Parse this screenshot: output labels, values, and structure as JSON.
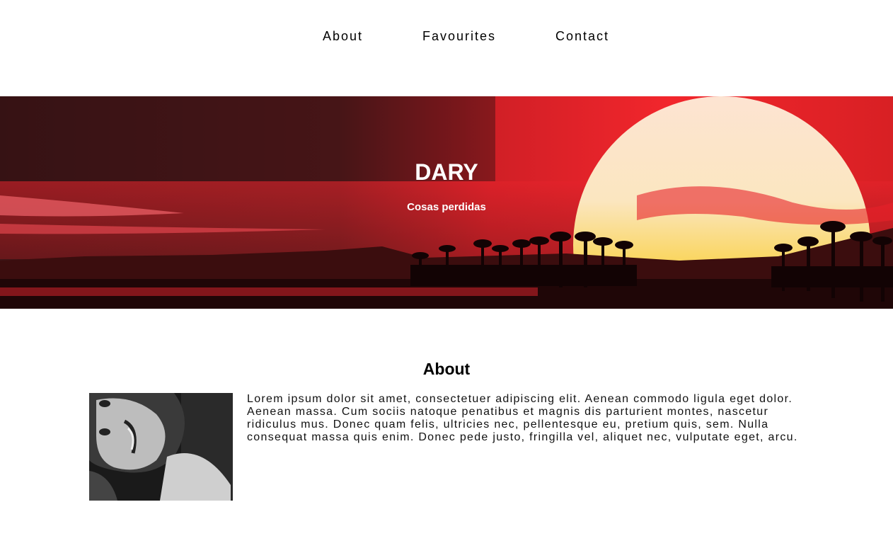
{
  "nav": {
    "items": [
      {
        "label": "About"
      },
      {
        "label": "Favourites"
      },
      {
        "label": "Contact"
      }
    ]
  },
  "hero": {
    "title": "DARY",
    "subtitle": "Cosas perdidas"
  },
  "about": {
    "heading": "About",
    "text": "Lorem ipsum dolor sit amet, consectetuer adipiscing elit. Aenean commodo ligula eget dolor. Aenean massa. Cum sociis natoque penatibus et magnis dis parturient montes, nascetur ridiculus mus. Donec quam felis, ultricies nec, pellentesque eu, pretium quis, sem. Nulla consequat massa quis enim. Donec pede justo, fringilla vel, aliquet nec, vulputate eget, arcu."
  },
  "colors": {
    "hero_sky_dark": "#3a1414",
    "hero_red": "#e8222a",
    "sun": "#fbe0c8",
    "text": "#000000"
  }
}
